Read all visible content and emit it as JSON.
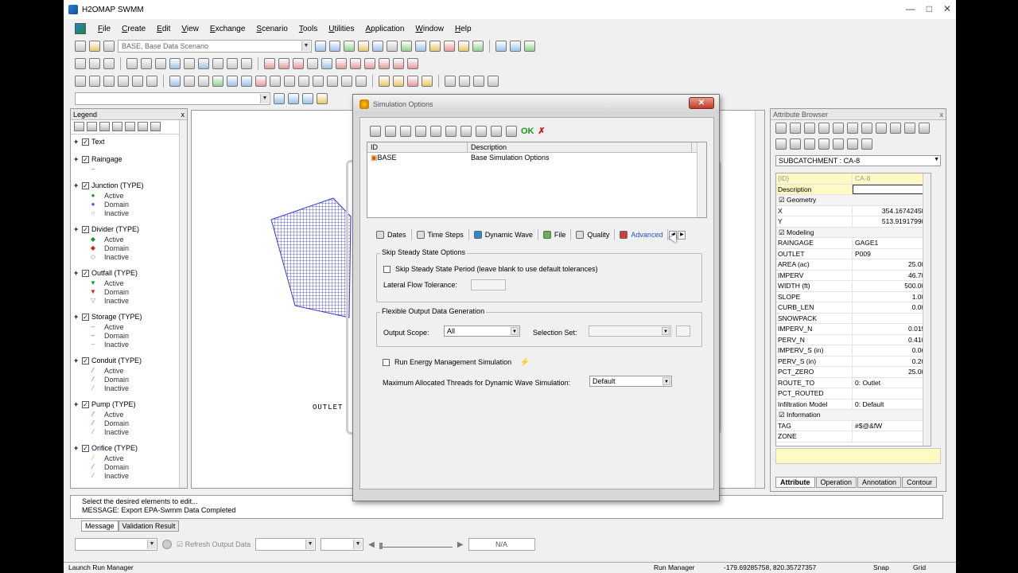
{
  "app": {
    "title": "H2OMAP SWMM",
    "window_controls": [
      "—",
      "□",
      "✕"
    ]
  },
  "menu": [
    "File",
    "Create",
    "Edit",
    "View",
    "Exchange",
    "Scenario",
    "Tools",
    "Utilities",
    "Application",
    "Window",
    "Help"
  ],
  "toolbar": {
    "scenario_combo": "BASE, Base Data Scenario"
  },
  "legend": {
    "title": "Legend",
    "close": "x",
    "groups": [
      {
        "label": "Text",
        "subs": []
      },
      {
        "label": "Raingage",
        "subs": [
          {
            "sym": "–",
            "color": "#2a6fd0",
            "label": ""
          }
        ]
      },
      {
        "label": "Junction (TYPE)",
        "subs": [
          {
            "sym": "●",
            "color": "#1a9a1a",
            "label": "Active"
          },
          {
            "sym": "●",
            "color": "#3355ee",
            "label": "Domain"
          },
          {
            "sym": "○",
            "color": "#888888",
            "label": "Inactive"
          }
        ]
      },
      {
        "label": "Divider (TYPE)",
        "subs": [
          {
            "sym": "◆",
            "color": "#1a9a1a",
            "label": "Active"
          },
          {
            "sym": "◆",
            "color": "#d02020",
            "label": "Domain"
          },
          {
            "sym": "◇",
            "color": "#888888",
            "label": "Inactive"
          }
        ]
      },
      {
        "label": "Outfall (TYPE)",
        "subs": [
          {
            "sym": "▼",
            "color": "#1a9a1a",
            "label": "Active"
          },
          {
            "sym": "▼",
            "color": "#d02020",
            "label": "Domain"
          },
          {
            "sym": "▽",
            "color": "#888888",
            "label": "Inactive"
          }
        ]
      },
      {
        "label": "Storage (TYPE)",
        "subs": [
          {
            "sym": "–",
            "color": "#1a9a1a",
            "label": "Active"
          },
          {
            "sym": "–",
            "color": "#3355ee",
            "label": "Domain"
          },
          {
            "sym": "–",
            "color": "#888888",
            "label": "Inactive"
          }
        ]
      },
      {
        "label": "Conduit (TYPE)",
        "subs": [
          {
            "sym": "⁄",
            "color": "#3355ee",
            "label": "Active"
          },
          {
            "sym": "⁄",
            "color": "#3355ee",
            "label": "Domain"
          },
          {
            "sym": "⁄",
            "color": "#888888",
            "label": "Inactive"
          }
        ]
      },
      {
        "label": "Pump (TYPE)",
        "subs": [
          {
            "sym": "⁄",
            "color": "#d02020",
            "label": "Active"
          },
          {
            "sym": "⁄",
            "color": "#d02020",
            "label": "Domain"
          },
          {
            "sym": "⁄",
            "color": "#888888",
            "label": "Inactive"
          }
        ]
      },
      {
        "label": "Orifice (TYPE)",
        "subs": [
          {
            "sym": "⁄",
            "color": "#e0a020",
            "label": "Active"
          },
          {
            "sym": "⁄",
            "color": "#d02020",
            "label": "Domain"
          },
          {
            "sym": "⁄",
            "color": "#888888",
            "label": "Inactive"
          }
        ]
      }
    ]
  },
  "map": {
    "outlet_label": "OUTLET",
    "subcatchment_color": "#3a3acc"
  },
  "dialog": {
    "title": "Simulation Options",
    "close": "✕",
    "table_headers": [
      "ID",
      "Description"
    ],
    "rows": [
      {
        "id": "BASE",
        "desc": "Base Simulation Options"
      }
    ],
    "tabs": [
      "Dates",
      "Time Steps",
      "Dynamic Wave",
      "File",
      "Quality",
      "Advanced"
    ],
    "active_tab": "Advanced",
    "skip_group": "Skip Steady State Options",
    "skip_check": "Skip Steady State Period (leave blank to use default tolerances)",
    "lateral_label": "Lateral Flow Tolerance:",
    "lateral_value": "",
    "flex_group": "Flexible Output Data Generation",
    "output_scope_label": "Output Scope:",
    "output_scope_value": "All",
    "selection_set_label": "Selection Set:",
    "selection_set_value": "",
    "energy_check": "Run Energy Management Simulation",
    "threads_label": "Maximum Allocated Threads for Dynamic Wave Simulation:",
    "threads_value": "Default"
  },
  "attr": {
    "title": "Attribute Browser",
    "close": "x",
    "selector": "SUBCATCHMENT : CA-8",
    "rows": [
      {
        "t": "ro",
        "k": "{ID}",
        "v": "CA-8",
        "align": "l"
      },
      {
        "t": "desc",
        "k": "Description",
        "v": ""
      },
      {
        "t": "cat",
        "k": "Geometry"
      },
      {
        "t": "row",
        "k": "X",
        "v": "354.1674245​85"
      },
      {
        "t": "row",
        "k": "Y",
        "v": "513.9191799​03"
      },
      {
        "t": "cat",
        "k": "Modeling"
      },
      {
        "t": "row",
        "k": "RAINGAGE",
        "v": "GAGE1",
        "align": "l"
      },
      {
        "t": "row",
        "k": "OUTLET",
        "v": "P009",
        "align": "l"
      },
      {
        "t": "row",
        "k": "AREA (ac)",
        "v": "25.000"
      },
      {
        "t": "row",
        "k": "IMPERV",
        "v": "46.700"
      },
      {
        "t": "row",
        "k": "WIDTH (ft)",
        "v": "500.000"
      },
      {
        "t": "row",
        "k": "SLOPE",
        "v": "1.000"
      },
      {
        "t": "row",
        "k": "CURB_LEN",
        "v": "0.000"
      },
      {
        "t": "row",
        "k": "SNOWPACK",
        "v": ""
      },
      {
        "t": "row",
        "k": "IMPERV_N",
        "v": "0.0150"
      },
      {
        "t": "row",
        "k": "PERV_N",
        "v": "0.4100"
      },
      {
        "t": "row",
        "k": "IMPERV_S (in)",
        "v": "0.060"
      },
      {
        "t": "row",
        "k": "PERV_S (in)",
        "v": "0.200"
      },
      {
        "t": "row",
        "k": "PCT_ZERO",
        "v": "25.000"
      },
      {
        "t": "row",
        "k": "ROUTE_TO",
        "v": "0: Outlet",
        "align": "l"
      },
      {
        "t": "row",
        "k": "PCT_ROUTED",
        "v": ""
      },
      {
        "t": "row",
        "k": "Infiltration Model",
        "v": "0: Default",
        "align": "l"
      },
      {
        "t": "cat",
        "k": "Information"
      },
      {
        "t": "row",
        "k": "TAG",
        "v": "#$@&fW",
        "align": "l"
      },
      {
        "t": "row",
        "k": "ZONE",
        "v": ""
      }
    ],
    "tabs": [
      "Attribute",
      "Operation",
      "Annotation",
      "Contour"
    ]
  },
  "messages": {
    "lines": [
      "Select the desired elements to edit...",
      "MESSAGE: Export EPA-Swmm Data Completed"
    ],
    "tabs": [
      "Message",
      "Validation Result"
    ]
  },
  "bottom": {
    "refresh_label": "Refresh Output Data",
    "na": "N/A"
  },
  "status": {
    "left": "Launch Run Manager",
    "run_manager": "Run Manager",
    "coords": "-179.69285758, 820.35727357",
    "snap": "Snap",
    "grid": "Grid"
  }
}
